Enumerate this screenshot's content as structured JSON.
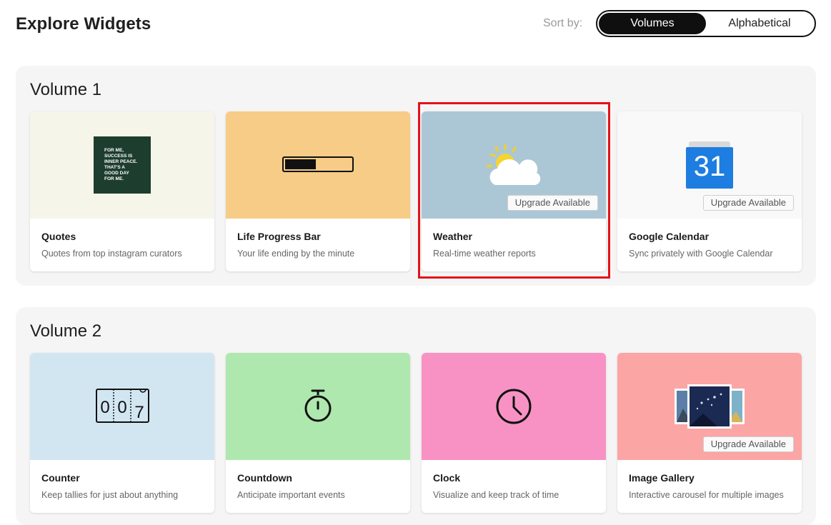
{
  "header": {
    "title": "Explore Widgets",
    "sort_label": "Sort by:",
    "sort_options": [
      "Volumes",
      "Alphabetical"
    ],
    "sort_selected": "Volumes"
  },
  "volumes": [
    {
      "title": "Volume 1",
      "cards": [
        {
          "name": "Quotes",
          "desc": "Quotes from top instagram curators",
          "bg": "#f6f5ea",
          "quote_lines": [
            "FOR ME,",
            "SUCCESS IS",
            "INNER PEACE.",
            "THAT'S A",
            "GOOD DAY",
            "FOR ME."
          ]
        },
        {
          "name": "Life Progress Bar",
          "desc": "Your life ending by the minute",
          "bg": "#f6cc86",
          "progress": 0.47
        },
        {
          "name": "Weather",
          "desc": "Real-time weather reports",
          "bg": "#abc7d6",
          "badge": "Upgrade Available",
          "highlighted": true
        },
        {
          "name": "Google Calendar",
          "desc": "Sync privately with Google Calendar",
          "bg": "#f9f9f9",
          "badge": "Upgrade Available",
          "calendar_day": "31"
        }
      ]
    },
    {
      "title": "Volume 2",
      "cards": [
        {
          "name": "Counter",
          "desc": "Keep tallies for just about anything",
          "bg": "#d2e6f2",
          "digits": [
            "0",
            "0",
            "7"
          ]
        },
        {
          "name": "Countdown",
          "desc": "Anticipate important events",
          "bg": "#aee8ae"
        },
        {
          "name": "Clock",
          "desc": "Visualize and keep track of time",
          "bg": "#f892c4"
        },
        {
          "name": "Image Gallery",
          "desc": "Interactive carousel for multiple images",
          "bg": "#fba5a5",
          "badge": "Upgrade Available"
        }
      ]
    }
  ],
  "colors": {
    "highlight": "#e3121a",
    "toggle_active_bg": "#0f0f0f",
    "volume_bg": "#f5f5f5"
  }
}
